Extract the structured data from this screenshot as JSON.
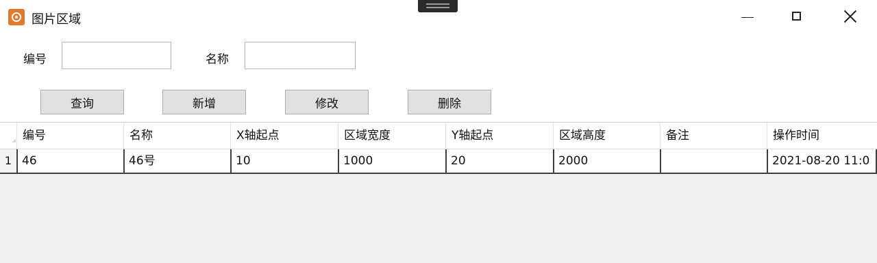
{
  "window": {
    "title": "图片区域",
    "minimize_icon": "minimize-icon",
    "maximize_icon": "maximize-icon",
    "close_icon": "close-icon"
  },
  "filters": {
    "code_label": "编号",
    "code_value": "",
    "name_label": "名称",
    "name_value": ""
  },
  "toolbar": {
    "query": "查询",
    "add": "新增",
    "edit": "修改",
    "delete": "删除"
  },
  "grid": {
    "columns": [
      "编号",
      "名称",
      "X轴起点",
      "区域宽度",
      "Y轴起点",
      "区域高度",
      "备注",
      "操作时间"
    ],
    "rows": [
      {
        "index": "1",
        "cells": [
          "46",
          "46号",
          "10",
          "1000",
          "20",
          "2000",
          "",
          "2021-08-20 11:0"
        ]
      }
    ]
  },
  "colors": {
    "button_bg": "#e1e1e1",
    "grid_bg": "#f0f0f0",
    "app_icon": "#e1782c"
  }
}
